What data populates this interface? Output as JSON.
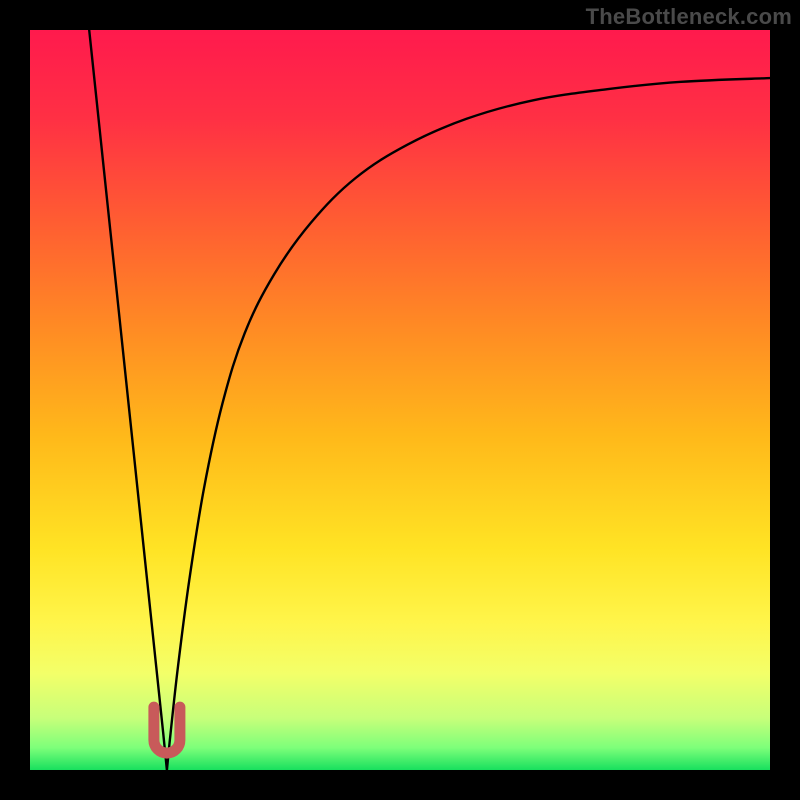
{
  "watermark": "TheBottleneck.com",
  "gradient_stops": [
    {
      "offset": 0.0,
      "color": "#ff1a4d"
    },
    {
      "offset": 0.12,
      "color": "#ff3044"
    },
    {
      "offset": 0.25,
      "color": "#ff5a33"
    },
    {
      "offset": 0.4,
      "color": "#ff8a24"
    },
    {
      "offset": 0.55,
      "color": "#ffb91a"
    },
    {
      "offset": 0.7,
      "color": "#ffe324"
    },
    {
      "offset": 0.8,
      "color": "#fff54a"
    },
    {
      "offset": 0.87,
      "color": "#f3ff69"
    },
    {
      "offset": 0.93,
      "color": "#c7ff7a"
    },
    {
      "offset": 0.97,
      "color": "#7dff7a"
    },
    {
      "offset": 1.0,
      "color": "#18e05e"
    }
  ],
  "marker": {
    "color": "#c85a5a",
    "stroke": "#c85a5a",
    "width": 26,
    "height": 46,
    "x_center_frac": 0.185,
    "y_top_frac": 0.915
  },
  "chart_data": {
    "type": "line",
    "title": "",
    "xlabel": "",
    "ylabel": "",
    "xlim": [
      0,
      1
    ],
    "ylim": [
      0,
      1
    ],
    "notes": "Axes are unlabeled; x and y are normalized 0–1 within the gradient plot area. A single black curve descends steeply from upper-left to a cusp near x≈0.185, y≈0 (marked with a small red 'U'), then rises with decreasing slope toward the upper-right.",
    "series": [
      {
        "name": "curve",
        "color": "#000000",
        "x": [
          0.08,
          0.09,
          0.1,
          0.11,
          0.12,
          0.13,
          0.14,
          0.15,
          0.16,
          0.17,
          0.18,
          0.185,
          0.19,
          0.2,
          0.215,
          0.235,
          0.26,
          0.29,
          0.33,
          0.38,
          0.44,
          0.51,
          0.59,
          0.68,
          0.78,
          0.88,
          1.0
        ],
        "y": [
          1.0,
          0.905,
          0.81,
          0.715,
          0.62,
          0.525,
          0.43,
          0.335,
          0.24,
          0.145,
          0.05,
          0.0,
          0.05,
          0.14,
          0.255,
          0.38,
          0.495,
          0.59,
          0.67,
          0.74,
          0.8,
          0.845,
          0.88,
          0.905,
          0.92,
          0.93,
          0.935
        ]
      }
    ],
    "annotations": [
      {
        "type": "cusp-marker",
        "shape": "U",
        "x": 0.185,
        "y": 0.0,
        "color": "#c85a5a"
      }
    ]
  }
}
